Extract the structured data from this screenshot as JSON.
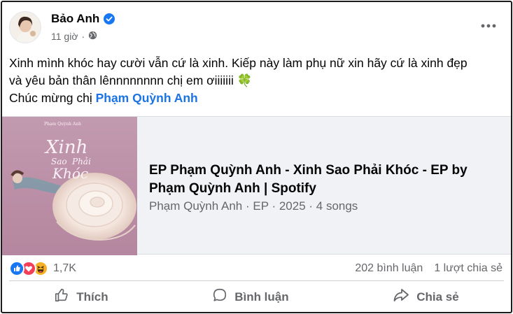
{
  "post": {
    "author": "Bảo Anh",
    "timestamp": "11 giờ",
    "separator": "·",
    "audience_icon": "globe-icon",
    "more_icon": "more-horizontal-icon",
    "text_line1": "Xinh mình khóc hay cười vẫn cứ là xinh. Kiếp này làm phụ nữ xin hãy cứ là xinh đẹp",
    "text_line2": "và yêu bản thân lênnnnnnnn chị em ơiiiiiii",
    "text_line2_emoji": "🍀",
    "text_line3_prefix": "Chúc mừng chị ",
    "mention": "Phạm Quỳnh Anh"
  },
  "link_preview": {
    "title": "EP Phạm Quỳnh Anh - Xinh Sao Phải Khóc - EP by Phạm Quỳnh Anh | Spotify",
    "subtitle": "Phạm Quỳnh Anh · EP · 2025 · 4 songs",
    "cover_text_top": "Phạm Quỳnh Anh",
    "cover_text_line1": "Xinh",
    "cover_text_line2": "Sao",
    "cover_text_line3": "Phải",
    "cover_text_line4": "Khóc"
  },
  "stats": {
    "reaction_icons": [
      "like-reaction-icon",
      "love-reaction-icon",
      "haha-reaction-icon"
    ],
    "reaction_count": "1,7K",
    "comments": "202 bình luận",
    "shares": "1 lượt chia sẻ"
  },
  "actions": {
    "like": "Thích",
    "comment": "Bình luận",
    "share": "Chia sẻ"
  },
  "colors": {
    "mention": "#1b74e4",
    "muted": "#65676b",
    "like": "#1877f2",
    "love": "#f33e58",
    "haha": "#f7b125"
  }
}
